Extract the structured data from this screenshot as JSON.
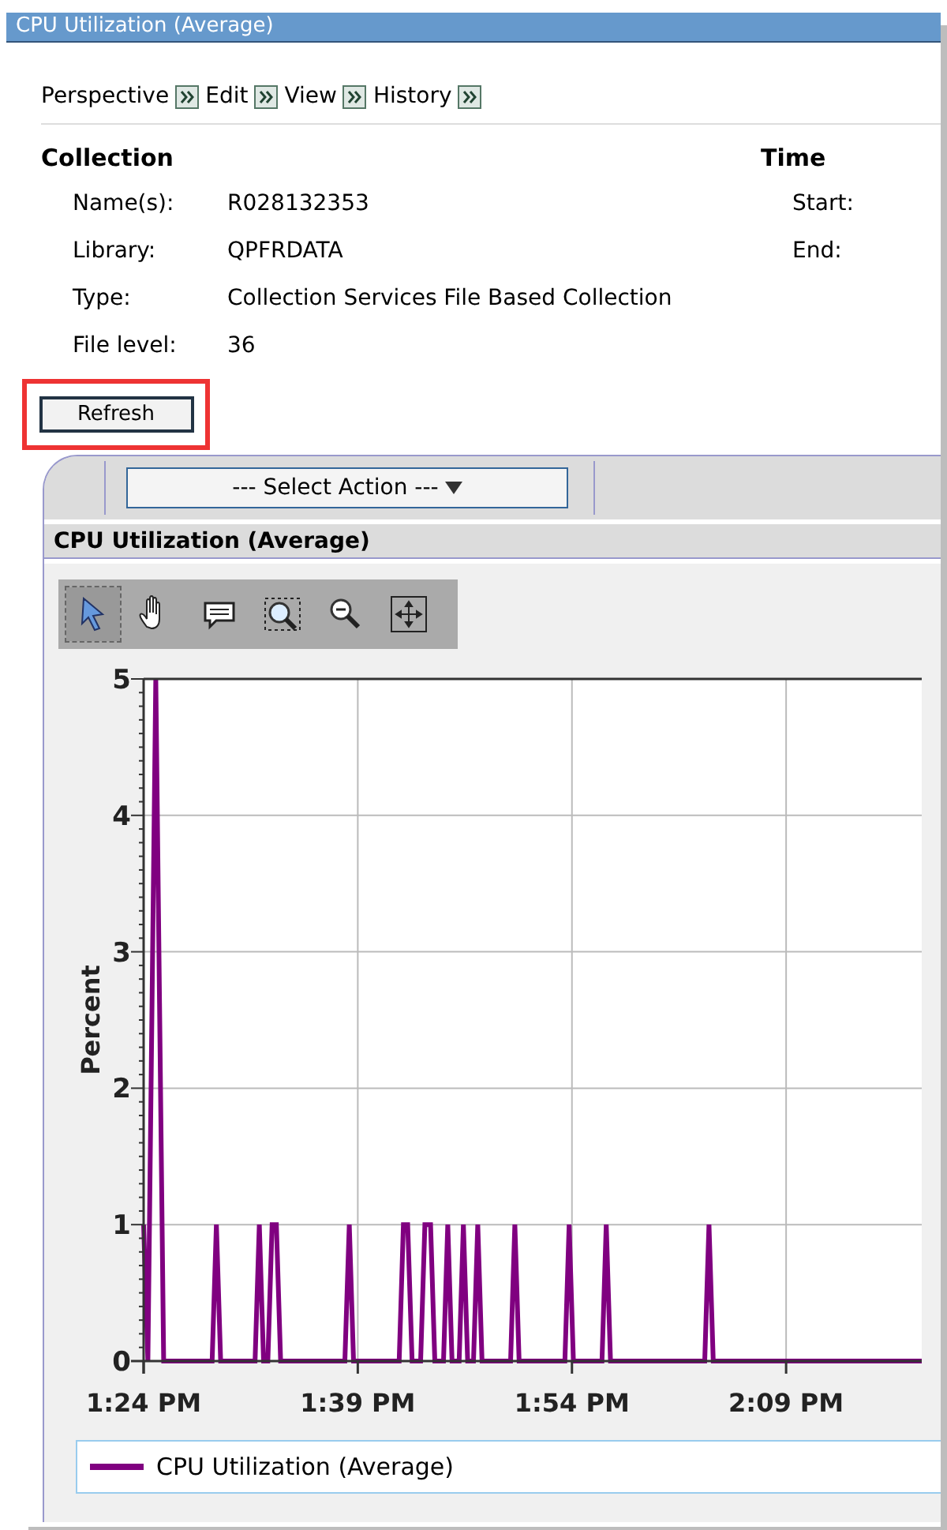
{
  "window": {
    "title": "CPU Utilization (Average)"
  },
  "menu": [
    {
      "label": "Perspective"
    },
    {
      "label": "Edit"
    },
    {
      "label": "View"
    },
    {
      "label": "History"
    }
  ],
  "collection": {
    "heading": "Collection",
    "fields": [
      {
        "label": "Name(s):",
        "value": "R028132353"
      },
      {
        "label": "Library:",
        "value": "QPFRDATA"
      },
      {
        "label": "Type:",
        "value": "Collection Services File Based Collection"
      },
      {
        "label": "File level:",
        "value": "36"
      }
    ]
  },
  "time": {
    "heading": "Time",
    "fields": [
      {
        "label": "Start:"
      },
      {
        "label": "End:"
      }
    ]
  },
  "refresh_button": {
    "label": "Refresh",
    "highlighted": true
  },
  "panel": {
    "select_action": "--- Select Action ---",
    "title": "CPU Utilization (Average)",
    "tools": [
      {
        "kind": "pointer",
        "selected": true
      },
      {
        "kind": "hand",
        "selected": false
      },
      {
        "kind": "bubble",
        "selected": false
      },
      {
        "kind": "zoombox",
        "selected": false
      },
      {
        "kind": "zoomout",
        "selected": false
      },
      {
        "kind": "pan",
        "selected": false
      }
    ],
    "chart_data": {
      "type": "line",
      "grid": true,
      "ylabel": "Percent",
      "xlim": [
        804,
        858.5
      ],
      "ylim": [
        0,
        5
      ],
      "x": [
        804,
        804.3,
        804.85,
        805.4,
        808.8,
        809.1,
        809.4,
        811.8,
        812.1,
        812.4,
        812.7,
        813,
        813.3,
        813.6,
        818.1,
        818.4,
        818.7,
        821.9,
        822.2,
        822.5,
        822.8,
        823.4,
        823.7,
        824.1,
        824.4,
        825,
        825.3,
        825.6,
        826.1,
        826.4,
        826.7,
        827.1,
        827.4,
        827.7,
        829.7,
        830,
        830.3,
        833.5,
        833.8,
        834.1,
        836.1,
        836.4,
        836.7,
        843.3,
        843.6,
        843.9,
        858.5
      ],
      "yticks": [
        0,
        1,
        2,
        3,
        4,
        5
      ],
      "xticks": [
        {
          "value": 804,
          "label": "1:24 PM"
        },
        {
          "value": 819,
          "label": "1:39 PM"
        },
        {
          "value": 834,
          "label": "1:54 PM"
        },
        {
          "value": 849,
          "label": "2:09 PM"
        }
      ],
      "series": [
        {
          "name": "CPU Utilization (Average)",
          "color": "#800080",
          "values": [
            1,
            0,
            5,
            0,
            0,
            1,
            0,
            0,
            1,
            0,
            0,
            1,
            1,
            0,
            0,
            1,
            0,
            0,
            1,
            1,
            0,
            0,
            1,
            1,
            0,
            0,
            1,
            0,
            0,
            1,
            0,
            0,
            1,
            0,
            0,
            1,
            0,
            0,
            1,
            0,
            0,
            1,
            0,
            0,
            1,
            0,
            0
          ]
        }
      ]
    }
  }
}
